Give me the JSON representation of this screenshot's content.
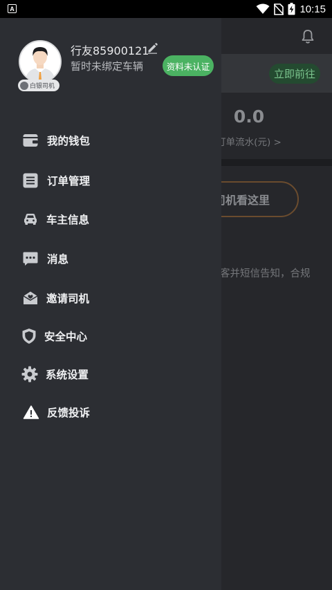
{
  "status_bar": {
    "notification_icon": "A",
    "time": "10:15",
    "icons": [
      "wifi-icon",
      "no-sim-icon",
      "battery-charging-icon"
    ]
  },
  "background_page": {
    "go_button_label": "立即前往",
    "stat_value": "0.0",
    "stat_label": "订单流水(元) >",
    "driver_button_label": "司机看这里",
    "notice_text": "客并短信告知，合规"
  },
  "drawer": {
    "profile": {
      "name": "行友85900121",
      "vehicle_status": "暂时未绑定车辆",
      "verify_button_label": "资料未认证",
      "role_badge": "白银司机"
    },
    "menu_items": [
      {
        "label": "我的钱包",
        "icon": "wallet-icon"
      },
      {
        "label": "订单管理",
        "icon": "order-list-icon"
      },
      {
        "label": "车主信息",
        "icon": "car-icon"
      },
      {
        "label": "消息",
        "icon": "message-icon"
      },
      {
        "label": "邀请司机",
        "icon": "invite-icon"
      },
      {
        "label": "安全中心",
        "icon": "shield-icon"
      },
      {
        "label": "系统设置",
        "icon": "gear-icon"
      },
      {
        "label": "反馈投诉",
        "icon": "warning-icon"
      }
    ]
  },
  "colors": {
    "drawer_bg": "#2c2e33",
    "accent_green": "#4bb262",
    "icon_grey": "#c9cbcf"
  }
}
